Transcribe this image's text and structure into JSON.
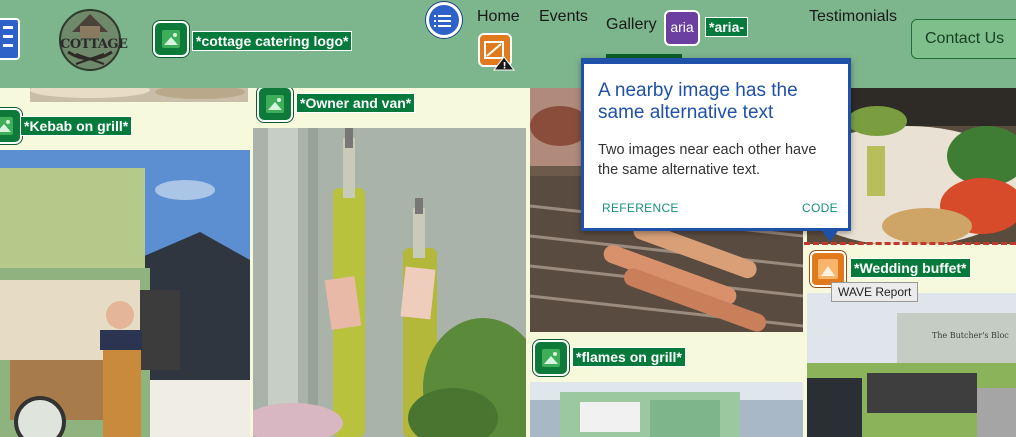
{
  "header": {
    "logo_text": "COTTAGE",
    "logo_alt": "*cottage catering logo*",
    "nav": {
      "home": "Home",
      "events": "Events",
      "gallery": "Gallery",
      "testimonials": "Testimonials"
    },
    "aria_badge": "aria",
    "aria_label": "*aria-",
    "contact_button": "Contact Us"
  },
  "gallery": {
    "kebab_alt": "*Kebab on grill*",
    "owner_alt": "*Owner and van*",
    "flames_alt": "*flames on grill*",
    "wedding_alt": "*Wedding buffet*"
  },
  "popup": {
    "title": "A nearby image has the same alternative text",
    "body": "Two images near each other have the same alternative text.",
    "reference": "REFERENCE",
    "code": "CODE"
  },
  "tooltip": "WAVE Report",
  "colors": {
    "header_bg": "#7db58d",
    "wave_green": "#067a3a",
    "wave_blue": "#1f51a8",
    "aria_purple": "#6b3fa0",
    "alert_orange": "#e07a1c"
  }
}
